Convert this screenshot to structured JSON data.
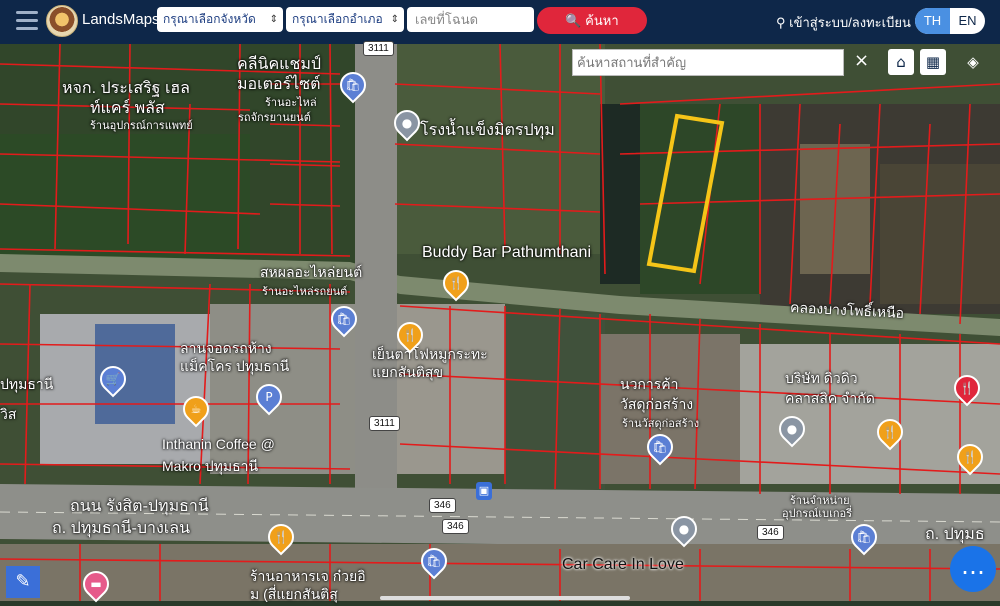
{
  "header": {
    "brand": "LandsMaps",
    "province_select": "กรุณาเลือกจังหวัด",
    "amphoe_select": "กรุณาเลือกอำเภอ",
    "deed_placeholder": "เลขที่โฉนด",
    "search_label": "ค้นหา",
    "login_label": "เข้าสู่ระบบ/ลงทะเบียน",
    "lang_th": "TH",
    "lang_en": "EN"
  },
  "map_toolbar": {
    "place_search_placeholder": "ค้นหาสถานที่สำคัญ",
    "close_label": "×"
  },
  "places": {
    "clinic": "หจก. ประเสริฐ เฮล",
    "clinic2": "ท์แคร์ พลัส",
    "clinic3": "ร้านอุปกรณ์การแพทย์",
    "motor": "คลีนิคแชมป์",
    "motor2": "มอเตอร์ไซต์",
    "motor3": "ร้านอะไหล่",
    "motor4": "รถจักรยานยนต์",
    "ice": "โรงน้ำแข็งมิตรปทุม",
    "buddy": "Buddy Bar Pathumthani",
    "parts": "สหผลอะไหล่ยนต์",
    "parts2": "ร้านอะไหล่รถยนต์",
    "canal": "คลองบางโพธิ์เหนือ",
    "pathum": "ปทุมธานี",
    "lot": "ลานจอดรถห้าง",
    "lot2": "แม็คโคร ปทุมธานี",
    "yen": "เย็นตาโฟหมูกระทะ",
    "yen2": "แยกสันติสุข",
    "navakarn": "นวการค้า",
    "navakarn2": "วัสดุก่อสร้าง",
    "navakarn3": "ร้านวัสดุก่อสร้าง",
    "company": "บริษัท ดิวดิว",
    "company2": "คลาสสิค จำกัด",
    "coffee": "Inthanin Coffee @",
    "coffee2": "Makro ปทุมธานี",
    "road1": "ถนน รังสิต-ปทุมธานี",
    "road2": "ถ. ปทุมธานี-บางเลน",
    "road3": "ถ. ปทุมธ",
    "shop": "ร้านจำหน่าย",
    "shop2": "อุปกรณ์เบเกอรี่",
    "restaurant": "ร้านอาหารเจ ก๋วยอิ",
    "restaurant2": "ม (สี่แยกสันติสุ",
    "carcare": "Car Care In Love",
    "left1": "ปทุมธานี",
    "left2": "วิส"
  },
  "road_shields": {
    "r3111_top": "3111",
    "r3111": "3111",
    "r346a": "346",
    "r346b": "346",
    "r346c": "346"
  },
  "colors": {
    "header_bg": "#0e2749",
    "search_btn": "#e0263b",
    "parcel_lines": "#e31b1b",
    "highlight": "#f5c518",
    "fab": "#1a73e8"
  }
}
